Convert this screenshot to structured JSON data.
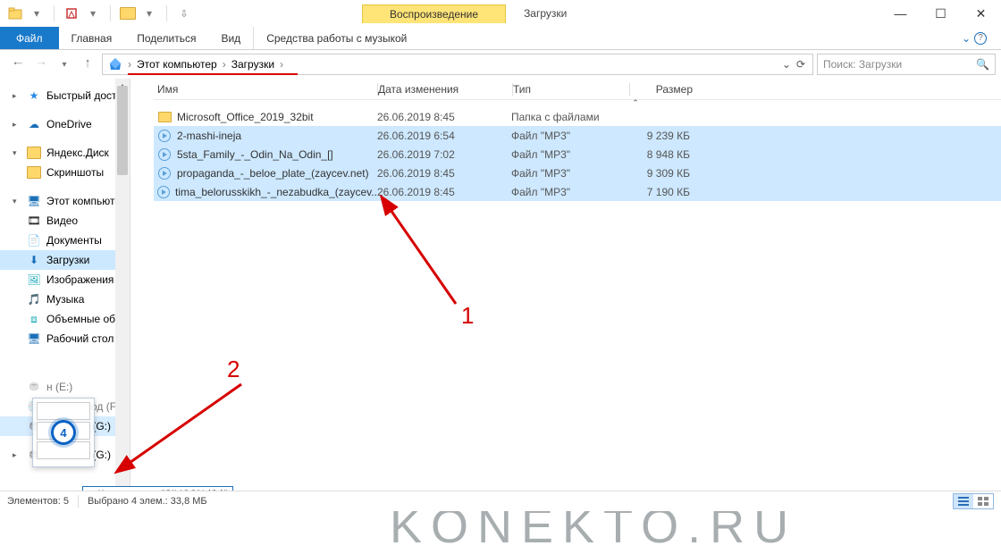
{
  "window": {
    "title": "Загрузки",
    "context_tab": "Воспроизведение",
    "ribbon_music_tools": "Средства работы с музыкой"
  },
  "ribbon": {
    "file": "Файл",
    "home": "Главная",
    "share": "Поделиться",
    "view": "Вид"
  },
  "address": {
    "seg1": "Этот компьютер",
    "seg2": "Загрузки"
  },
  "search": {
    "placeholder": "Поиск: Загрузки"
  },
  "nav": {
    "quick": "Быстрый доступ",
    "onedrive": "OneDrive",
    "yadisk": "Яндекс.Диск",
    "screenshots": "Скриншоты",
    "thispc": "Этот компьютер",
    "video": "Видео",
    "documents": "Документы",
    "downloads": "Загрузки",
    "pictures": "Изображения",
    "music": "Музыка",
    "objects3d": "Объемные объ",
    "desktop": "Рабочий стол",
    "drive_e": "н (E:)",
    "drive_f": "С дисковод (F:",
    "drive_g": "SILICON (G:)",
    "ext_silicon": "SILICON (G:)"
  },
  "columns": {
    "name": "Имя",
    "date": "Дата изменения",
    "type": "Тип",
    "size": "Размер"
  },
  "rows": [
    {
      "icon": "folder",
      "name": "Microsoft_Office_2019_32bit",
      "date": "26.06.2019 8:45",
      "type": "Папка с файлами",
      "size": "",
      "sel": false
    },
    {
      "icon": "mp3",
      "name": "2-mashi-ineja",
      "date": "26.06.2019 6:54",
      "type": "Файл \"MP3\"",
      "size": "9 239 КБ",
      "sel": true
    },
    {
      "icon": "mp3",
      "name": "5sta_Family_-_Odin_Na_Odin_[]",
      "date": "26.06.2019 7:02",
      "type": "Файл \"MP3\"",
      "size": "8 948 КБ",
      "sel": true
    },
    {
      "icon": "mp3",
      "name": "propaganda_-_beloe_plate_(zaycev.net)",
      "date": "26.06.2019 8:45",
      "type": "Файл \"MP3\"",
      "size": "9 309 КБ",
      "sel": true
    },
    {
      "icon": "mp3",
      "name": "tima_belorusskikh_-_nezabudka_(zaycev....",
      "date": "26.06.2019 8:45",
      "type": "Файл \"MP3\"",
      "size": "7 190 КБ",
      "sel": true
    }
  ],
  "drag": {
    "count": "4",
    "tooltip": "Копировать в \"SILICON (G:)\""
  },
  "status": {
    "count": "Элементов: 5",
    "selection": "Выбрано 4 элем.: 33,8 МБ"
  },
  "annot": {
    "n1": "1",
    "n2": "2",
    "watermark": "KONEKTO.RU"
  }
}
